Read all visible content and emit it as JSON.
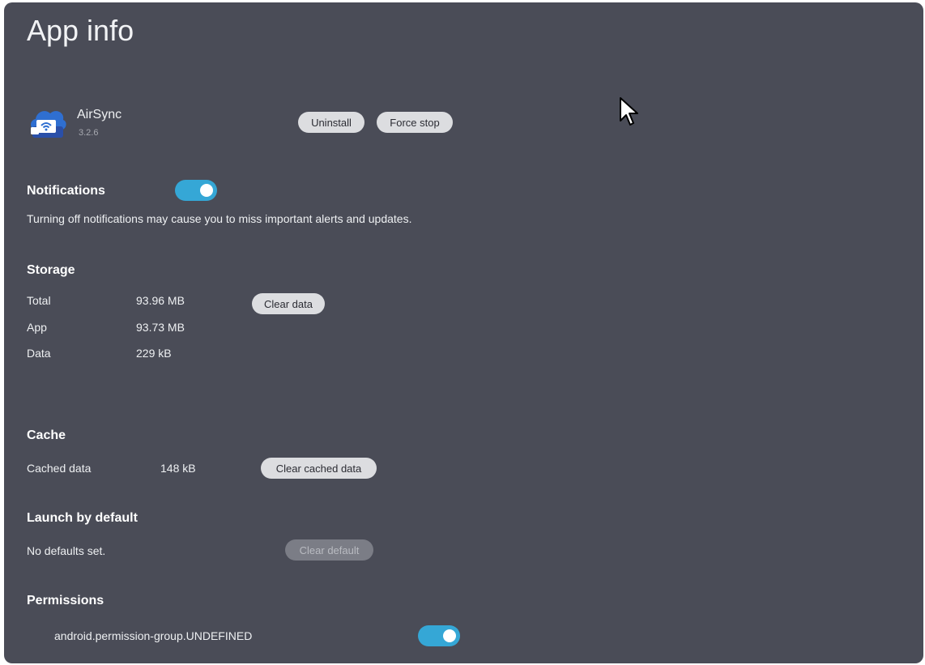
{
  "header": {
    "title": "App info"
  },
  "app": {
    "name": "AirSync",
    "version": "3.2.6",
    "icon": "airsync-app-icon",
    "uninstall_label": "Uninstall",
    "force_stop_label": "Force stop"
  },
  "notifications": {
    "heading": "Notifications",
    "enabled": true,
    "description": "Turning off notifications may cause you to miss important alerts and updates."
  },
  "storage": {
    "heading": "Storage",
    "rows": [
      {
        "label": "Total",
        "value": "93.96 MB"
      },
      {
        "label": "App",
        "value": "93.73 MB"
      },
      {
        "label": "Data",
        "value": "229 kB"
      }
    ],
    "clear_data_label": "Clear data"
  },
  "cache": {
    "heading": "Cache",
    "label": "Cached data",
    "value": "148 kB",
    "clear_label": "Clear cached data"
  },
  "launch": {
    "heading": "Launch by default",
    "status": "No defaults set.",
    "clear_label": "Clear default",
    "clear_enabled": false
  },
  "permissions": {
    "heading": "Permissions",
    "items": [
      {
        "label": "android.permission-group.UNDEFINED",
        "enabled": true
      }
    ]
  },
  "colors": {
    "background": "#4a4c57",
    "accent": "#35a7d6",
    "button": "#dcdde0"
  }
}
